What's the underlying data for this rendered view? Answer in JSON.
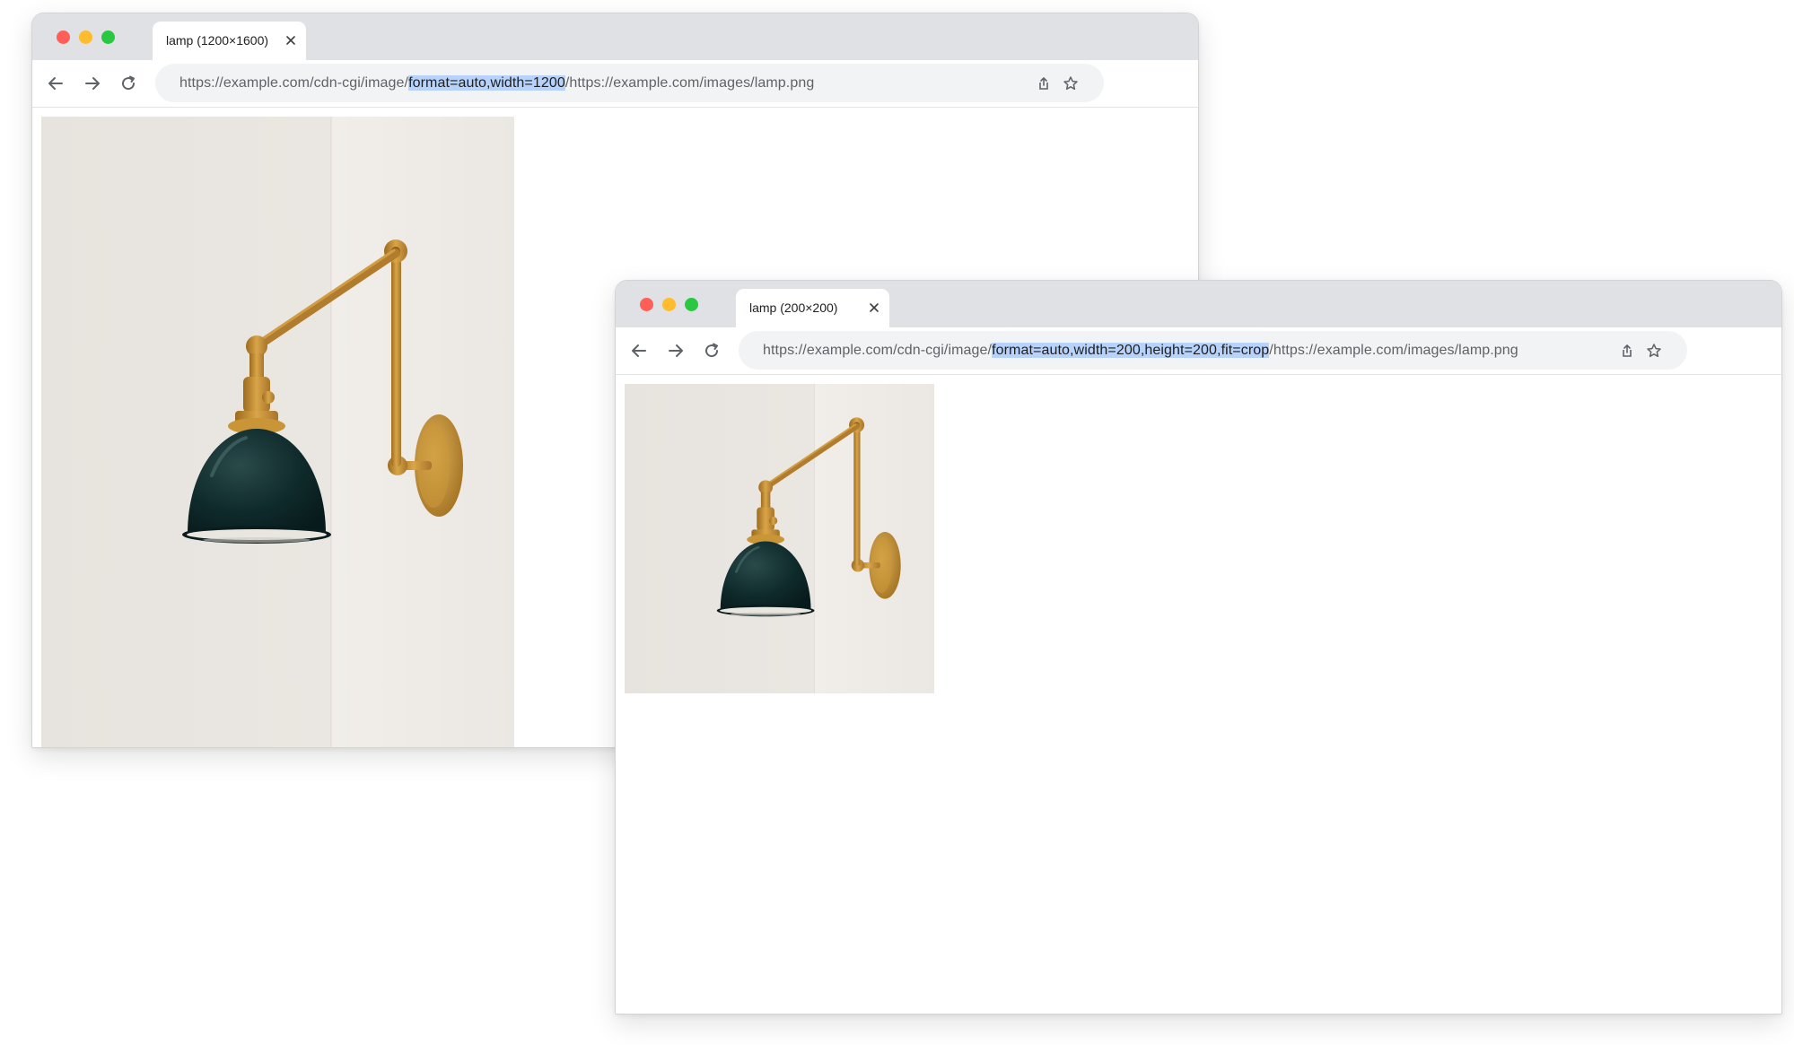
{
  "windows": [
    {
      "tab_title": "lamp (1200×1600)",
      "url_prefix": "https://example.com/cdn-cgi/image/",
      "url_highlight": "format=auto,width=1200",
      "url_suffix": "/https://example.com/images/lamp.png",
      "image_alt": "lamp"
    },
    {
      "tab_title": "lamp (200×200)",
      "url_prefix": "https://example.com/cdn-cgi/image/",
      "url_highlight": "format=auto,width=200,height=200,fit=crop",
      "url_suffix": "/https://example.com/images/lamp.png",
      "image_alt": "lamp"
    }
  ],
  "icons": {
    "back": "arrow-left-icon",
    "forward": "arrow-right-icon",
    "reload": "reload-icon",
    "share": "share-icon",
    "bookmark": "star-icon",
    "close_tab": "close-icon"
  },
  "colors": {
    "titlebar": "#dfe1e5",
    "omnibox": "#f1f3f4",
    "url_highlight": "#b7d3fb",
    "traffic_red": "#ff5f57",
    "traffic_yellow": "#febc2e",
    "traffic_green": "#28c840",
    "lamp_shade": "#0f2a2b",
    "brass": "#c08a2f"
  }
}
